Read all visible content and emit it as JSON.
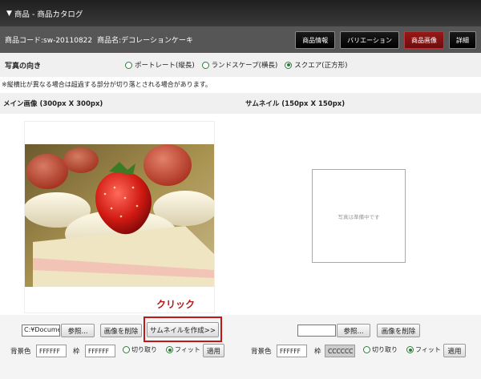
{
  "title": "商品 - 商品カタログ",
  "info": {
    "code": "商品コード:sw-20110822",
    "name": "商品名:デコレーションケーキ"
  },
  "tabs": [
    {
      "label": "商品情報",
      "active": false
    },
    {
      "label": "バリエーション",
      "active": false
    },
    {
      "label": "商品画像",
      "active": true
    },
    {
      "label": "詳細",
      "active": false
    }
  ],
  "orientation": {
    "label": "写真の向き",
    "options": [
      {
        "label": "ポートレート(縦長)",
        "selected": false
      },
      {
        "label": "ランドスケープ(横長)",
        "selected": false
      },
      {
        "label": "スクエア(正方形)",
        "selected": true
      }
    ]
  },
  "note": "※縦横比が異なる場合は超過する部分が切り落とされる場合があります。",
  "main_image": {
    "heading": "メイン画像 (300px X 300px)",
    "file_value": "C:¥Documer",
    "browse": "参照...",
    "delete": "画像を削除",
    "make_thumb": "サムネイルを作成>>",
    "bg_label": "背景色",
    "bg_value": "FFFFFF",
    "border_label": "枠",
    "border_value": "FFFFFF",
    "crop": "切り取り",
    "fit": "フィット",
    "apply": "適用"
  },
  "thumbnail": {
    "heading": "サムネイル (150px X 150px)",
    "placeholder": "写真は準備中です",
    "browse": "参照...",
    "delete": "画像を削除",
    "bg_label": "背景色",
    "bg_value": "FFFFFF",
    "border_label": "枠",
    "border_value": "CCCCCC",
    "crop": "切り取り",
    "fit": "フィット",
    "apply": "適用"
  },
  "callout": "クリック",
  "colors": {
    "accent": "#8a1414",
    "callout": "#c01818",
    "radio": "#2f7d3c"
  }
}
